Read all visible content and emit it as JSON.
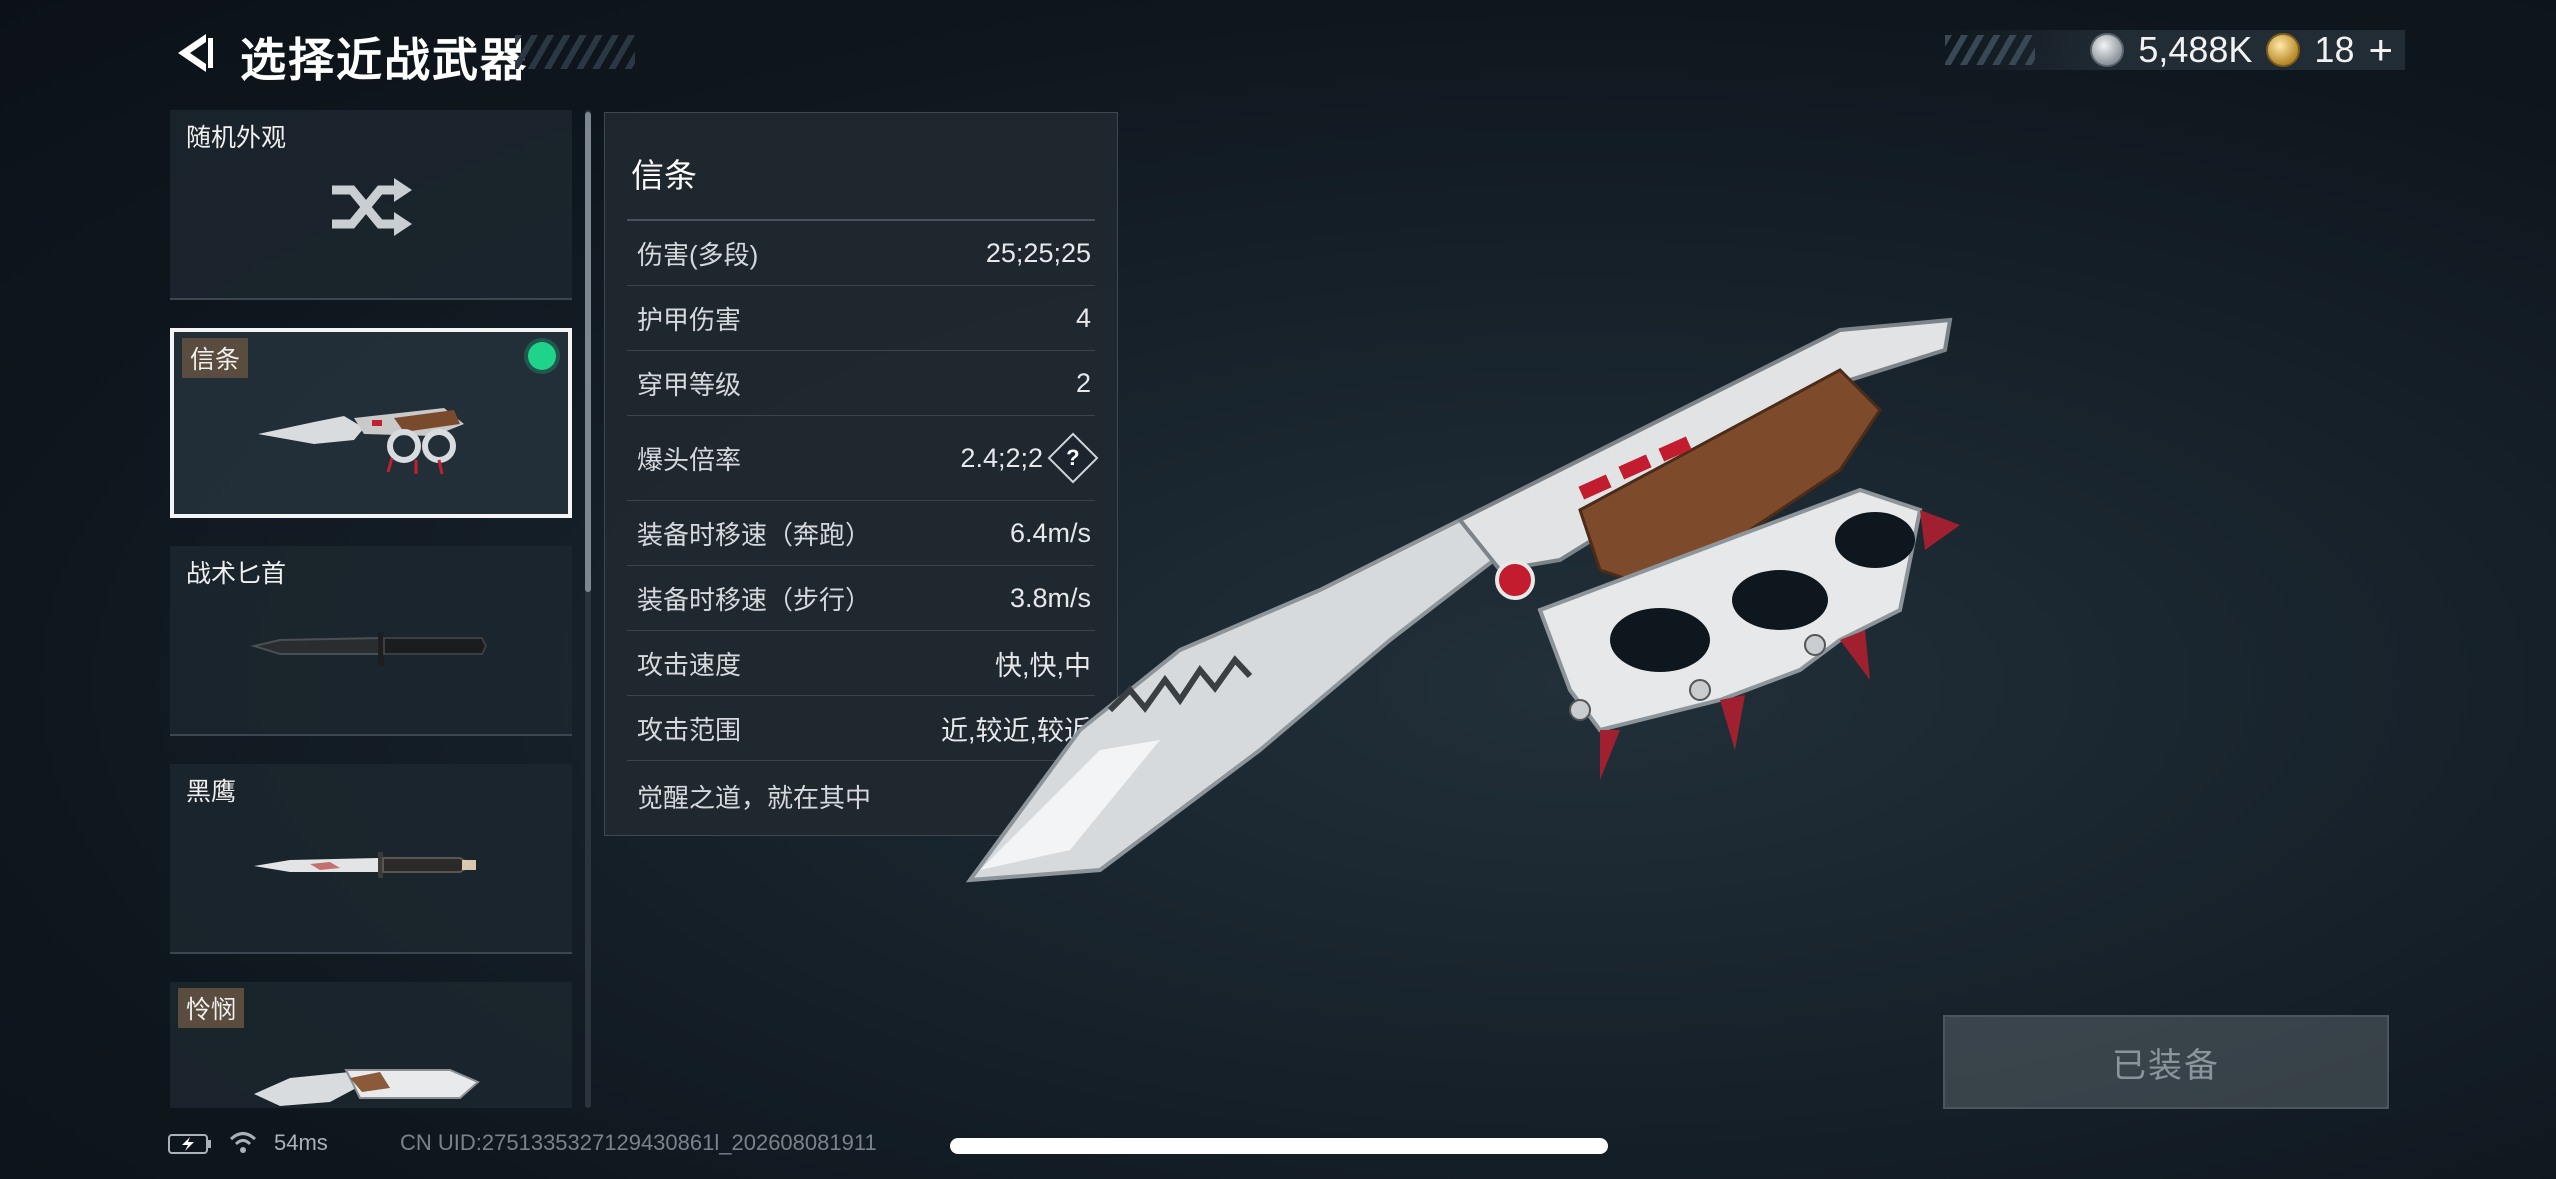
{
  "header": {
    "title": "选择近战武器",
    "back_icon": "chevron-left-icon"
  },
  "currency": {
    "silver_value": "5,488K",
    "gold_value": "18",
    "add_label": "+"
  },
  "weapon_list": [
    {
      "label": "随机外观",
      "icon": "shuffle-icon",
      "selected": false,
      "equipped": false
    },
    {
      "label": "信条",
      "icon": "creed-knife-icon",
      "selected": true,
      "equipped": true
    },
    {
      "label": "战术匕首",
      "icon": "tactical-dagger-icon",
      "selected": false,
      "equipped": false
    },
    {
      "label": "黑鹰",
      "icon": "black-hawk-knife-icon",
      "selected": false,
      "equipped": false
    },
    {
      "label": "怜悯",
      "icon": "mercy-knife-icon",
      "selected": false,
      "equipped": false
    }
  ],
  "details": {
    "name": "信条",
    "stats": [
      {
        "key": "伤害(多段)",
        "value": "25;25;25"
      },
      {
        "key": "护甲伤害",
        "value": "4"
      },
      {
        "key": "穿甲等级",
        "value": "2"
      },
      {
        "key": "爆头倍率",
        "value": "2.4;2;2"
      },
      {
        "key": "装备时移速（奔跑）",
        "value": "6.4m/s"
      },
      {
        "key": "装备时移速（步行）",
        "value": "3.8m/s"
      },
      {
        "key": "攻击速度",
        "value": "快,快,中"
      },
      {
        "key": "攻击范围",
        "value": "近,较近,较近"
      }
    ],
    "help_label": "?",
    "motto": "觉醒之道，就在其中"
  },
  "equip_button": {
    "label": "已装备"
  },
  "status_bar": {
    "ping": "54ms",
    "uid": "CN UID:2751335327129430861l_202608081911"
  },
  "colors": {
    "equipped_dot": "#1fd38a",
    "tag_bg": "#5a4c3e",
    "panel_bg": "#202830"
  }
}
